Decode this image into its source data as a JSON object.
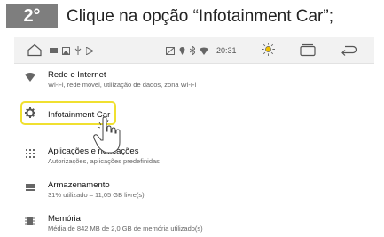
{
  "step": {
    "number": "2°",
    "text": "Clique na opção “Infotainment Car”;"
  },
  "statusbar": {
    "time": "20:31"
  },
  "settings": [
    {
      "title": "Rede e Internet",
      "subtitle": "Wi-Fi, rede móvel, utilização de dados, zona Wi-Fi",
      "icon": "wifi-icon"
    },
    {
      "title": "Infotainment Car",
      "subtitle": "",
      "icon": "gear-icon"
    },
    {
      "title": "Aplicações e no..cações",
      "subtitle": "Autorizações, aplicações predefinidas",
      "icon": "apps-grid-icon"
    },
    {
      "title": "Armazenamento",
      "subtitle": "31% utilizado – 11,05 GB livre(s)",
      "icon": "storage-icon"
    },
    {
      "title": "Memória",
      "subtitle": "Média de 842 MB de 2,0 GB de memória utilizado(s)",
      "icon": "memory-icon"
    }
  ],
  "colors": {
    "badge": "#7e7e7e",
    "highlight": "#f0e030",
    "topbar": "#f2f2f2"
  }
}
